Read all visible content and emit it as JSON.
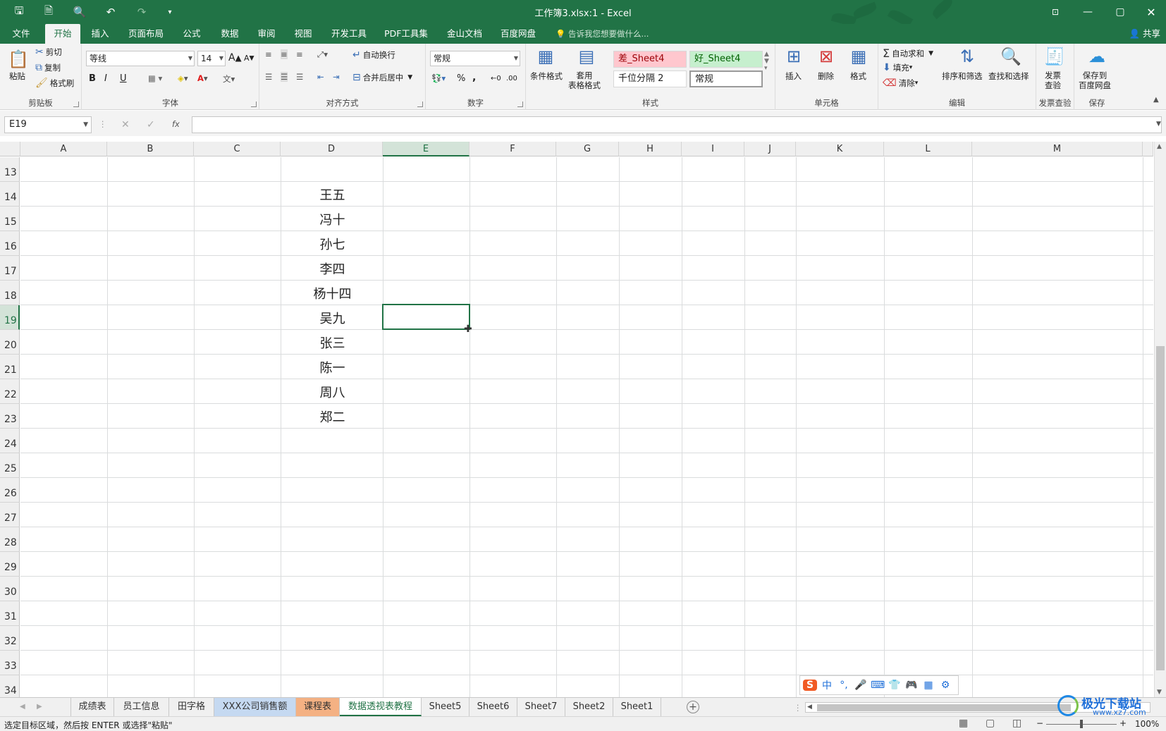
{
  "app": {
    "title": "工作簿3.xlsx:1 - Excel",
    "share": "共享"
  },
  "ribbon_tabs": [
    "文件",
    "开始",
    "插入",
    "页面布局",
    "公式",
    "数据",
    "审阅",
    "视图",
    "开发工具",
    "PDF工具集",
    "金山文档",
    "百度网盘"
  ],
  "active_tab": "开始",
  "tell_me": "告诉我您想要做什么...",
  "clipboard": {
    "paste": "粘贴",
    "cut": "剪切",
    "copy": "复制",
    "format_painter": "格式刷",
    "label": "剪贴板"
  },
  "font": {
    "name": "等线",
    "size": "14",
    "bold": "B",
    "italic": "I",
    "underline": "U",
    "grow": "A",
    "shrink": "A",
    "label": "字体"
  },
  "alignment": {
    "wrap": "自动换行",
    "merge": "合并后居中",
    "label": "对齐方式"
  },
  "number": {
    "format": "常规",
    "percent": "%",
    "comma": ",",
    "label": "数字"
  },
  "styles": {
    "conditional": "条件格式",
    "table_format": "套用\n表格格式",
    "cells": [
      "差_Sheet4",
      "好_Sheet4",
      "千位分隔 2",
      "常规"
    ],
    "label": "样式"
  },
  "cells_group": {
    "insert": "插入",
    "delete": "删除",
    "format": "格式",
    "label": "单元格"
  },
  "editing": {
    "autosum": "自动求和",
    "fill": "填充",
    "clear": "清除",
    "sort": "排序和筛选",
    "find": "查找和选择",
    "label": "编辑"
  },
  "invoice": {
    "check": "发票\n查验",
    "label": "发票查验"
  },
  "save_group": {
    "save": "保存到\n百度网盘",
    "label": "保存"
  },
  "formula_bar": {
    "name_box": "E19",
    "fx": "fx",
    "value": ""
  },
  "columns": [
    "A",
    "B",
    "C",
    "D",
    "E",
    "F",
    "G",
    "H",
    "I",
    "J",
    "K",
    "L",
    "M"
  ],
  "selected_column": "E",
  "rows": [
    "13",
    "14",
    "15",
    "16",
    "17",
    "18",
    "19",
    "20",
    "21",
    "22",
    "23",
    "24",
    "25",
    "26",
    "27",
    "28",
    "29",
    "30",
    "31",
    "32",
    "33",
    "34"
  ],
  "selected_row": "19",
  "column_d_values": [
    {
      "row": "14",
      "value": "王五"
    },
    {
      "row": "15",
      "value": "冯十"
    },
    {
      "row": "16",
      "value": "孙七"
    },
    {
      "row": "17",
      "value": "李四"
    },
    {
      "row": "18",
      "value": "杨十四"
    },
    {
      "row": "19",
      "value": "吴九"
    },
    {
      "row": "20",
      "value": "张三"
    },
    {
      "row": "21",
      "value": "陈一"
    },
    {
      "row": "22",
      "value": "周八"
    },
    {
      "row": "23",
      "value": "郑二"
    }
  ],
  "sheet_tabs": [
    "成绩表",
    "员工信息",
    "田字格",
    "XXX公司销售额",
    "课程表",
    "数据透视表教程",
    "Sheet5",
    "Sheet6",
    "Sheet7",
    "Sheet2",
    "Sheet1"
  ],
  "active_sheet": "数据透视表教程",
  "tab_colors": {
    "XXX公司销售额": "#c5d9f1",
    "课程表": "#f4b183"
  },
  "status": {
    "message": "选定目标区域，然后按 ENTER 或选择\"粘贴\"",
    "zoom": "100%"
  },
  "ime": {
    "items": [
      "中",
      "°,",
      "mic",
      "kbd",
      "shirt",
      "game",
      "grid",
      "gear"
    ]
  },
  "watermark": {
    "site": "极光下载站",
    "url": "www.xz7.com"
  },
  "colors": {
    "accent": "#217346",
    "bad": "#ffc7ce",
    "good": "#c6efce"
  }
}
